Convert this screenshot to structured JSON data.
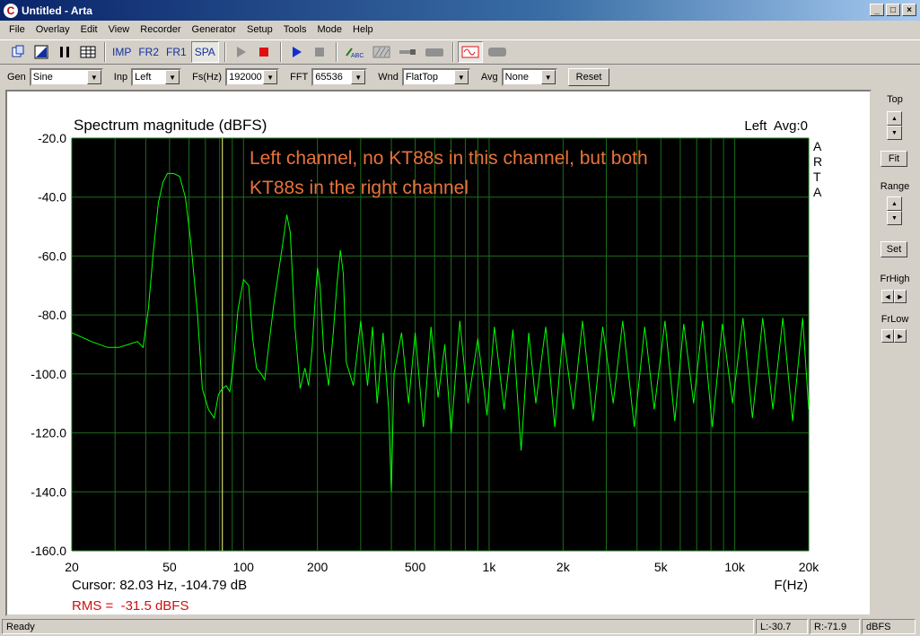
{
  "window": {
    "title": "Untitled - Arta"
  },
  "menu": [
    "File",
    "Overlay",
    "Edit",
    "View",
    "Recorder",
    "Generator",
    "Setup",
    "Tools",
    "Mode",
    "Help"
  ],
  "toolbar": {
    "imp": "IMP",
    "fr2": "FR2",
    "fr1": "FR1",
    "spa": "SPA",
    "abc": "ABC"
  },
  "controls": {
    "gen_label": "Gen",
    "gen_value": "Sine",
    "inp_label": "Inp",
    "inp_value": "Left",
    "fs_label": "Fs(Hz)",
    "fs_value": "192000",
    "fft_label": "FFT",
    "fft_value": "65536",
    "wnd_label": "Wnd",
    "wnd_value": "FlatTop",
    "avg_label": "Avg",
    "avg_value": "None",
    "reset": "Reset"
  },
  "side": {
    "top": "Top",
    "fit": "Fit",
    "range": "Range",
    "set": "Set",
    "frhigh": "FrHigh",
    "frlow": "FrLow"
  },
  "plot": {
    "info": "Left  Avg:0",
    "annotation_line1": "Left channel, no KT88s in this channel, but both",
    "annotation_line2": "KT88s in the right channel",
    "arta_letters": [
      "A",
      "R",
      "T",
      "A"
    ],
    "cursor": "Cursor: 82.03 Hz, -104.79 dB",
    "rms": "RMS =  -31.5 dBFS"
  },
  "chart_data": {
    "type": "line",
    "title": "Spectrum magnitude (dBFS)",
    "xlabel": "F(Hz)",
    "ylabel": "",
    "x_scale": "log",
    "xlim": [
      20,
      20000
    ],
    "ylim": [
      -160,
      -20
    ],
    "x_ticks": [
      20,
      50,
      100,
      200,
      500,
      1000,
      2000,
      5000,
      10000,
      20000
    ],
    "x_tick_labels": [
      "20",
      "50",
      "100",
      "200",
      "500",
      "1k",
      "2k",
      "5k",
      "10k",
      "20k"
    ],
    "y_ticks": [
      -20,
      -40,
      -60,
      -80,
      -100,
      -120,
      -140,
      -160
    ],
    "y_tick_labels": [
      "-20.0",
      "-40.0",
      "-60.0",
      "-80.0",
      "-100.0",
      "-120.0",
      "-140.0",
      "-160.0"
    ],
    "cursor_hz": 82.03,
    "series": [
      {
        "color": "#00ff00",
        "points": [
          [
            20,
            -86
          ],
          [
            24,
            -89
          ],
          [
            28,
            -91
          ],
          [
            31,
            -91
          ],
          [
            34,
            -90
          ],
          [
            37,
            -89
          ],
          [
            39,
            -91
          ],
          [
            41,
            -78
          ],
          [
            43,
            -58
          ],
          [
            45,
            -42
          ],
          [
            47,
            -35
          ],
          [
            49,
            -32
          ],
          [
            52,
            -32
          ],
          [
            55,
            -33
          ],
          [
            58,
            -40
          ],
          [
            61,
            -55
          ],
          [
            65,
            -80
          ],
          [
            68,
            -105
          ],
          [
            72,
            -112
          ],
          [
            76,
            -115
          ],
          [
            79,
            -107
          ],
          [
            82,
            -105
          ],
          [
            85,
            -104
          ],
          [
            88,
            -106
          ],
          [
            91,
            -96
          ],
          [
            95,
            -78
          ],
          [
            100,
            -68
          ],
          [
            105,
            -70
          ],
          [
            109,
            -88
          ],
          [
            113,
            -98
          ],
          [
            118,
            -100
          ],
          [
            122,
            -102
          ],
          [
            126,
            -92
          ],
          [
            133,
            -76
          ],
          [
            145,
            -55
          ],
          [
            150,
            -46
          ],
          [
            155,
            -52
          ],
          [
            162,
            -84
          ],
          [
            170,
            -105
          ],
          [
            178,
            -98
          ],
          [
            184,
            -104
          ],
          [
            190,
            -92
          ],
          [
            196,
            -74
          ],
          [
            200,
            -64
          ],
          [
            205,
            -70
          ],
          [
            212,
            -92
          ],
          [
            222,
            -104
          ],
          [
            232,
            -86
          ],
          [
            240,
            -70
          ],
          [
            248,
            -58
          ],
          [
            255,
            -66
          ],
          [
            262,
            -96
          ],
          [
            280,
            -104
          ],
          [
            300,
            -82
          ],
          [
            320,
            -104
          ],
          [
            335,
            -84
          ],
          [
            350,
            -110
          ],
          [
            370,
            -86
          ],
          [
            390,
            -112
          ],
          [
            400,
            -140
          ],
          [
            410,
            -100
          ],
          [
            440,
            -86
          ],
          [
            470,
            -110
          ],
          [
            500,
            -86
          ],
          [
            540,
            -118
          ],
          [
            580,
            -84
          ],
          [
            620,
            -108
          ],
          [
            660,
            -90
          ],
          [
            700,
            -120
          ],
          [
            760,
            -82
          ],
          [
            820,
            -110
          ],
          [
            900,
            -88
          ],
          [
            980,
            -114
          ],
          [
            1050,
            -84
          ],
          [
            1150,
            -112
          ],
          [
            1250,
            -85
          ],
          [
            1350,
            -126
          ],
          [
            1450,
            -86
          ],
          [
            1550,
            -110
          ],
          [
            1700,
            -84
          ],
          [
            1850,
            -118
          ],
          [
            2000,
            -86
          ],
          [
            2200,
            -112
          ],
          [
            2400,
            -82
          ],
          [
            2650,
            -116
          ],
          [
            2900,
            -84
          ],
          [
            3200,
            -110
          ],
          [
            3500,
            -82
          ],
          [
            3900,
            -118
          ],
          [
            4300,
            -84
          ],
          [
            4700,
            -112
          ],
          [
            5200,
            -82
          ],
          [
            5700,
            -116
          ],
          [
            6200,
            -83
          ],
          [
            6800,
            -110
          ],
          [
            7400,
            -82
          ],
          [
            8100,
            -118
          ],
          [
            8900,
            -83
          ],
          [
            9800,
            -110
          ],
          [
            10800,
            -81
          ],
          [
            11800,
            -115
          ],
          [
            13000,
            -81
          ],
          [
            14300,
            -112
          ],
          [
            15700,
            -81
          ],
          [
            17200,
            -116
          ],
          [
            18900,
            -81
          ],
          [
            20000,
            -112
          ]
        ]
      }
    ]
  },
  "status": {
    "ready": "Ready",
    "l": "L:-30.7",
    "r": "R:-71.9",
    "unit": "dBFS"
  }
}
